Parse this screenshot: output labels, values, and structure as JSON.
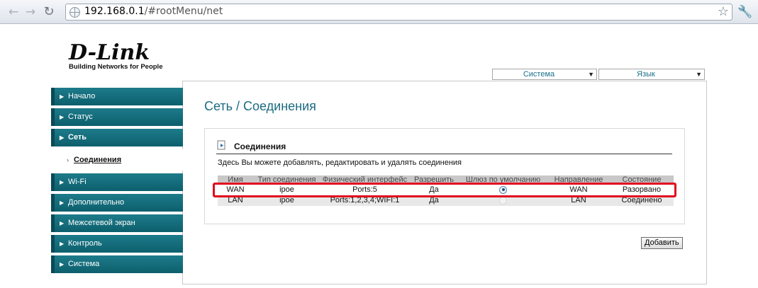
{
  "browser": {
    "url_host": "192.168.0.1",
    "url_path": "/#rootMenu/net"
  },
  "header": {
    "brand": "D-Link",
    "tagline": "Building Networks for People",
    "system_select": "Система",
    "language_select": "Язык"
  },
  "sidebar": {
    "items": [
      {
        "label": "Начало"
      },
      {
        "label": "Статус"
      },
      {
        "label": "Сеть"
      },
      {
        "label": "Wi-Fi"
      },
      {
        "label": "Дополнительно"
      },
      {
        "label": "Межсетевой экран"
      },
      {
        "label": "Контроль"
      },
      {
        "label": "Система"
      }
    ],
    "subitem": "Соединения"
  },
  "page": {
    "title": "Сеть  /  Соединения"
  },
  "panel": {
    "title": "Соединения",
    "description": "Здесь Вы можете добавлять, редактировать и удалять соединения",
    "columns": [
      "Имя",
      "Тип соединения",
      "Физический интерфейс",
      "Разрешить",
      "Шлюз по умолчанию",
      "Направление",
      "Состояние"
    ],
    "rows": [
      {
        "name": "WAN",
        "type": "ipoe",
        "iface": "Ports:5",
        "enabled": "Да",
        "gateway_selected": true,
        "direction": "WAN",
        "status": "Разорвано"
      },
      {
        "name": "LAN",
        "type": "ipoe",
        "iface": "Ports:1,2,3,4;WIFI:1",
        "enabled": "Да",
        "gateway_selected": false,
        "direction": "LAN",
        "status": "Соединено"
      }
    ],
    "add_button": "Добавить"
  },
  "colors": {
    "menu_bg": "#0d5f6d",
    "title": "#1b6b80",
    "highlight": "#e1091e"
  }
}
